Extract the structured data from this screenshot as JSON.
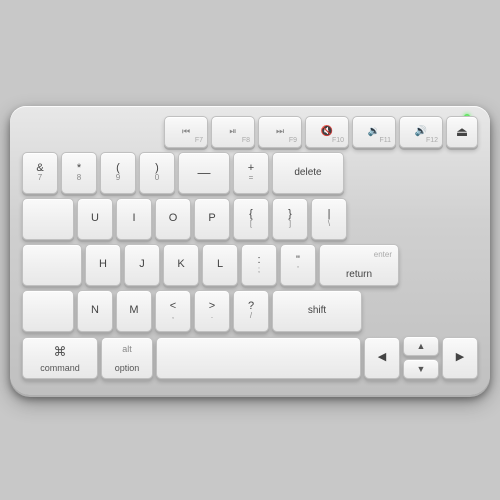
{
  "keyboard": {
    "indicator": "power-indicator",
    "rows": {
      "fn_row": [
        {
          "id": "f7",
          "icon": "⏮",
          "fn": "F7"
        },
        {
          "id": "f8",
          "icon": "⏯",
          "fn": "F8"
        },
        {
          "id": "f9",
          "icon": "⏭",
          "fn": "F9"
        },
        {
          "id": "f10",
          "icon": "◁",
          "fn": "F10"
        },
        {
          "id": "f11",
          "icon": "◁)",
          "fn": "F11"
        },
        {
          "id": "f12",
          "icon": "◁))",
          "fn": "F12"
        },
        {
          "id": "eject",
          "icon": "⏏",
          "fn": ""
        }
      ],
      "row1": [
        {
          "id": "amp7",
          "top": "&",
          "bot": "7"
        },
        {
          "id": "star8",
          "top": "*",
          "bot": "8"
        },
        {
          "id": "paren9",
          "top": "(",
          "bot": "9"
        },
        {
          "id": "paren0",
          "top": ")",
          "bot": "0"
        },
        {
          "id": "minus",
          "top": "—",
          "bot": "–"
        },
        {
          "id": "plus",
          "top": "+",
          "bot": "="
        },
        {
          "id": "delete",
          "label": "delete"
        }
      ],
      "row2": [
        {
          "id": "tab",
          "label": ""
        },
        {
          "id": "u",
          "label": "U"
        },
        {
          "id": "i",
          "label": "I"
        },
        {
          "id": "o",
          "label": "O"
        },
        {
          "id": "p",
          "label": "P"
        },
        {
          "id": "lbrace",
          "top": "{",
          "bot": "["
        },
        {
          "id": "rbrace",
          "top": "}",
          "bot": "]"
        },
        {
          "id": "backslash",
          "top": "|",
          "bot": "\\"
        }
      ],
      "row3": [
        {
          "id": "caps",
          "label": ""
        },
        {
          "id": "h",
          "label": "H"
        },
        {
          "id": "j",
          "label": "J"
        },
        {
          "id": "k",
          "label": "K"
        },
        {
          "id": "l",
          "label": "L"
        },
        {
          "id": "semi",
          "top": ":",
          "bot": ";"
        },
        {
          "id": "quote",
          "top": "\"",
          "bot": "'"
        },
        {
          "id": "return",
          "label": "return",
          "sub": "enter"
        }
      ],
      "row4": [
        {
          "id": "shift_left",
          "label": ""
        },
        {
          "id": "n",
          "label": "N"
        },
        {
          "id": "m",
          "label": "M"
        },
        {
          "id": "lt",
          "top": "<",
          "bot": ","
        },
        {
          "id": "gt",
          "top": ">",
          "bot": "."
        },
        {
          "id": "question",
          "top": "?",
          "bot": "/"
        },
        {
          "id": "shift_right",
          "label": "shift"
        }
      ],
      "row5": [
        {
          "id": "command",
          "icon": "⌘",
          "label": "command"
        },
        {
          "id": "option",
          "icon": "alt",
          "label": "option"
        },
        {
          "id": "space",
          "label": ""
        },
        {
          "id": "arrow_left",
          "icon": "◀"
        },
        {
          "id": "arrow_up",
          "icon": "▲"
        },
        {
          "id": "arrow_down",
          "icon": "▼"
        },
        {
          "id": "arrow_right",
          "icon": "▶"
        }
      ]
    }
  }
}
